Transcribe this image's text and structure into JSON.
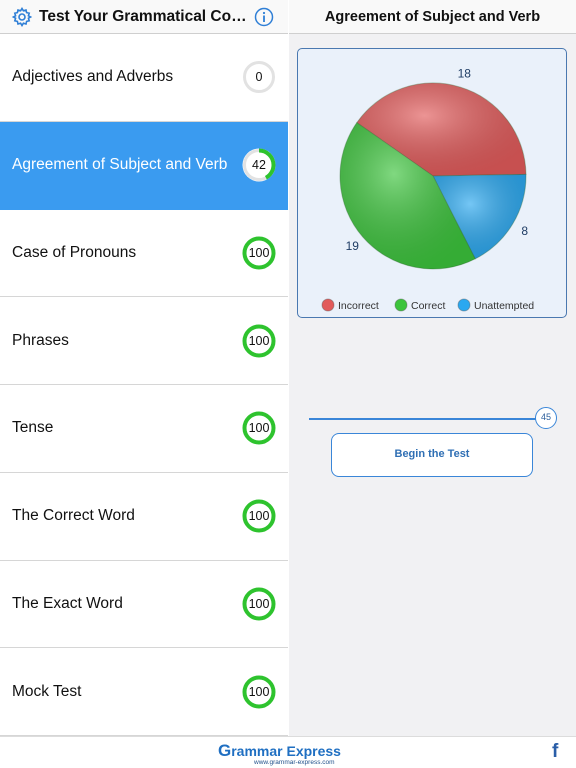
{
  "left_header": {
    "title": "Test Your Grammatical Cor…"
  },
  "topics": [
    {
      "label": "Adjectives and Adverbs",
      "score": "0",
      "percent": 0,
      "selected": false
    },
    {
      "label": "Agreement of Subject and Verb",
      "score": "42",
      "percent": 42,
      "selected": true
    },
    {
      "label": "Case of Pronouns",
      "score": "100",
      "percent": 100,
      "selected": false
    },
    {
      "label": "Phrases",
      "score": "100",
      "percent": 100,
      "selected": false
    },
    {
      "label": "Tense",
      "score": "100",
      "percent": 100,
      "selected": false
    },
    {
      "label": "The Correct Word",
      "score": "100",
      "percent": 100,
      "selected": false
    },
    {
      "label": "The Exact Word",
      "score": "100",
      "percent": 100,
      "selected": false
    },
    {
      "label": "Mock Test",
      "score": "100",
      "percent": 100,
      "selected": false
    }
  ],
  "right_header": {
    "title": "Agreement of Subject and Verb"
  },
  "chart_data": {
    "type": "pie",
    "slices": [
      {
        "label": "Incorrect",
        "value": 18,
        "color": "#e25b5b"
      },
      {
        "label": "Unattempted",
        "value": 8,
        "color": "#2aa8f0"
      },
      {
        "label": "Correct",
        "value": 19,
        "color": "#3cc43c"
      }
    ],
    "legend": [
      "Incorrect",
      "Correct",
      "Unattempted"
    ],
    "legend_placement": "bottom"
  },
  "slider": {
    "value": "45"
  },
  "begin_button": {
    "label": "Begin the Test"
  },
  "footer": {
    "logo_first": "G",
    "logo_rest": "rammar Express",
    "logo_url": "www.grammar-express.com",
    "facebook": "f"
  },
  "colors": {
    "accent": "#3a9bf0",
    "ring_green": "#2ec32e",
    "ring_track": "#e2e2e2"
  }
}
